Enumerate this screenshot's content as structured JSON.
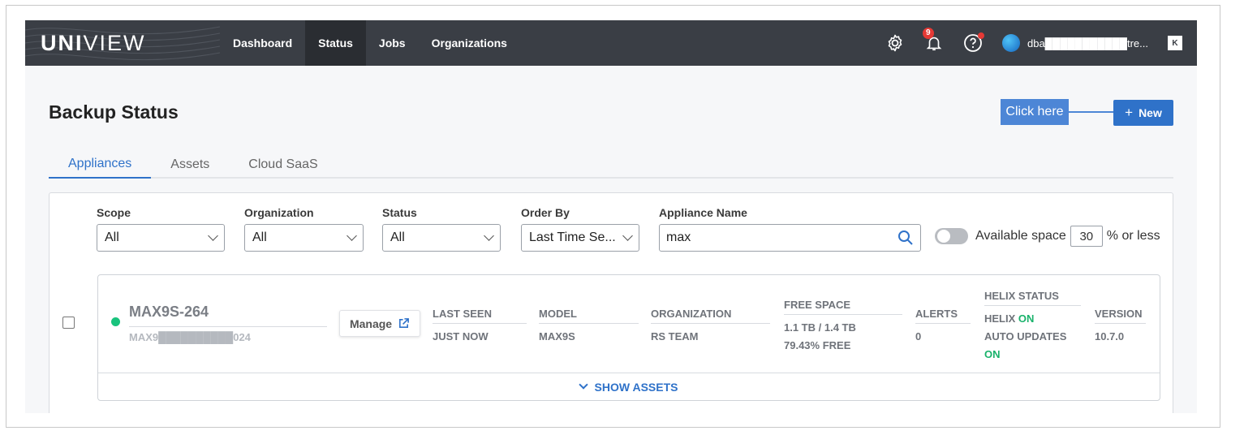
{
  "nav": {
    "logo_bold": "UNI",
    "logo_light": "VIEW",
    "items": [
      {
        "label": "Dashboard"
      },
      {
        "label": "Status"
      },
      {
        "label": "Jobs"
      },
      {
        "label": "Organizations"
      }
    ],
    "active": "Status",
    "notifications_count": "9",
    "username": "dba███████████tre...",
    "k_label": "K"
  },
  "page": {
    "title": "Backup Status",
    "callout": "Click here",
    "new_button": "New",
    "new_icon": "+"
  },
  "tabs": [
    {
      "label": "Appliances"
    },
    {
      "label": "Assets"
    },
    {
      "label": "Cloud SaaS"
    }
  ],
  "filters": {
    "scope": {
      "label": "Scope",
      "value": "All"
    },
    "organization": {
      "label": "Organization",
      "value": "All"
    },
    "status": {
      "label": "Status",
      "value": "All"
    },
    "order_by": {
      "label": "Order By",
      "value": "Last Time Se..."
    },
    "appliance_name": {
      "label": "Appliance Name",
      "value": "max"
    },
    "available_space": {
      "label": "Available space",
      "value": "30",
      "suffix": "% or less",
      "enabled": false
    }
  },
  "appliance": {
    "name": "MAX9S-264",
    "serial": "MAX9██████████024",
    "status_color": "#19c37d",
    "manage_label": "Manage",
    "last_seen": {
      "header": "LAST SEEN",
      "value": "JUST NOW"
    },
    "model": {
      "header": "MODEL",
      "value": "MAX9S"
    },
    "organization": {
      "header": "ORGANIZATION",
      "value": "RS TEAM"
    },
    "free_space": {
      "header": "FREE SPACE",
      "value": "1.1 TB / 1.4 TB",
      "percent": "79.43% FREE"
    },
    "alerts": {
      "header": "ALERTS",
      "value": "0"
    },
    "helix": {
      "header": "HELIX STATUS",
      "helix_label": "HELIX",
      "helix_value": "ON",
      "auto_label": "AUTO UPDATES",
      "auto_value": "ON"
    },
    "version": {
      "header": "VERSION",
      "value": "10.7.0"
    },
    "show_assets": "SHOW ASSETS"
  },
  "colors": {
    "accent": "#2f72c9",
    "topbar": "#3a3e45",
    "status_on": "#19b26b"
  }
}
